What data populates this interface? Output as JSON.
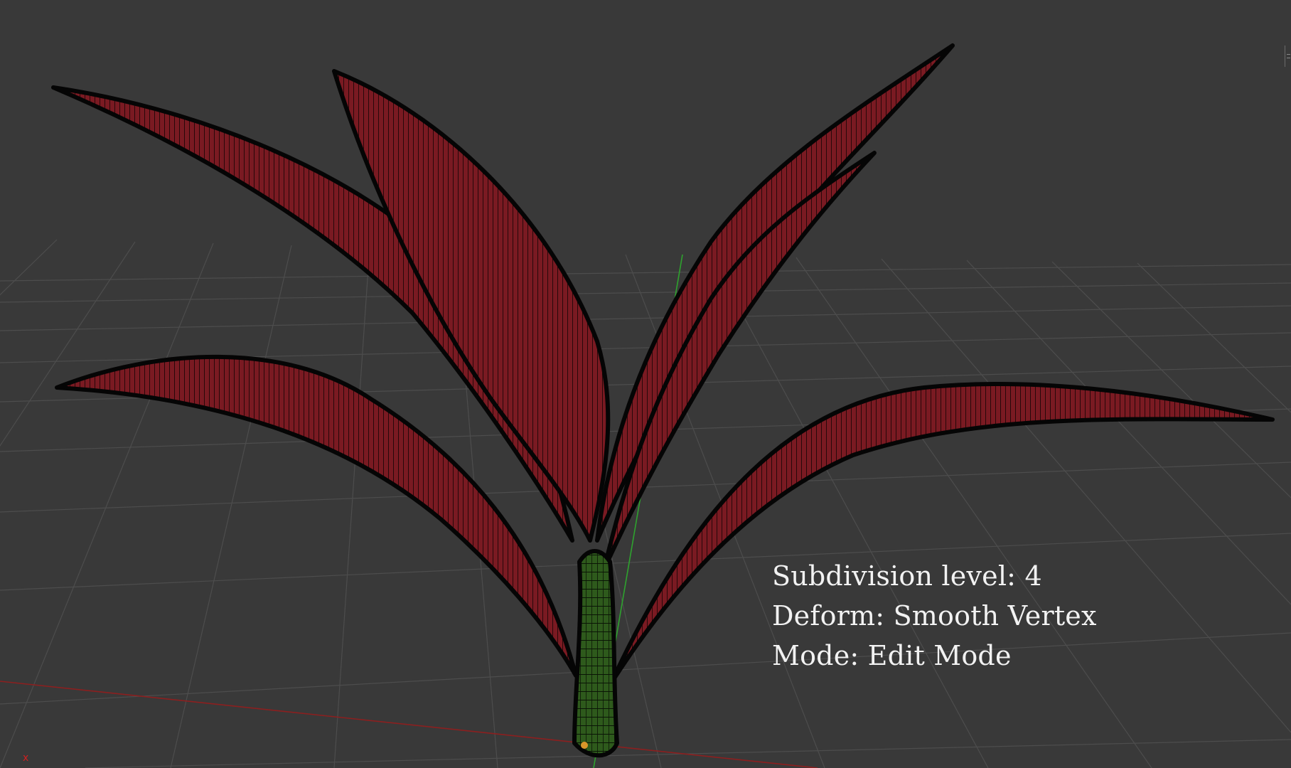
{
  "viewport": {
    "background_color": "#393939",
    "grid_color": "#4c4c4c",
    "x_axis_color": "#8c1f1f",
    "y_axis_color": "#2ea32e",
    "leaf_fill_color": "#7a1a22",
    "leaf_wire_color": "#050505",
    "stem_fill_color": "#2e5a1c",
    "origin_color": "#d9962a",
    "axis_label": "x"
  },
  "overlay": {
    "subdivision": "Subdivision level: 4",
    "deform": "Deform: Smooth Vertex",
    "mode": "Mode: Edit Mode"
  }
}
